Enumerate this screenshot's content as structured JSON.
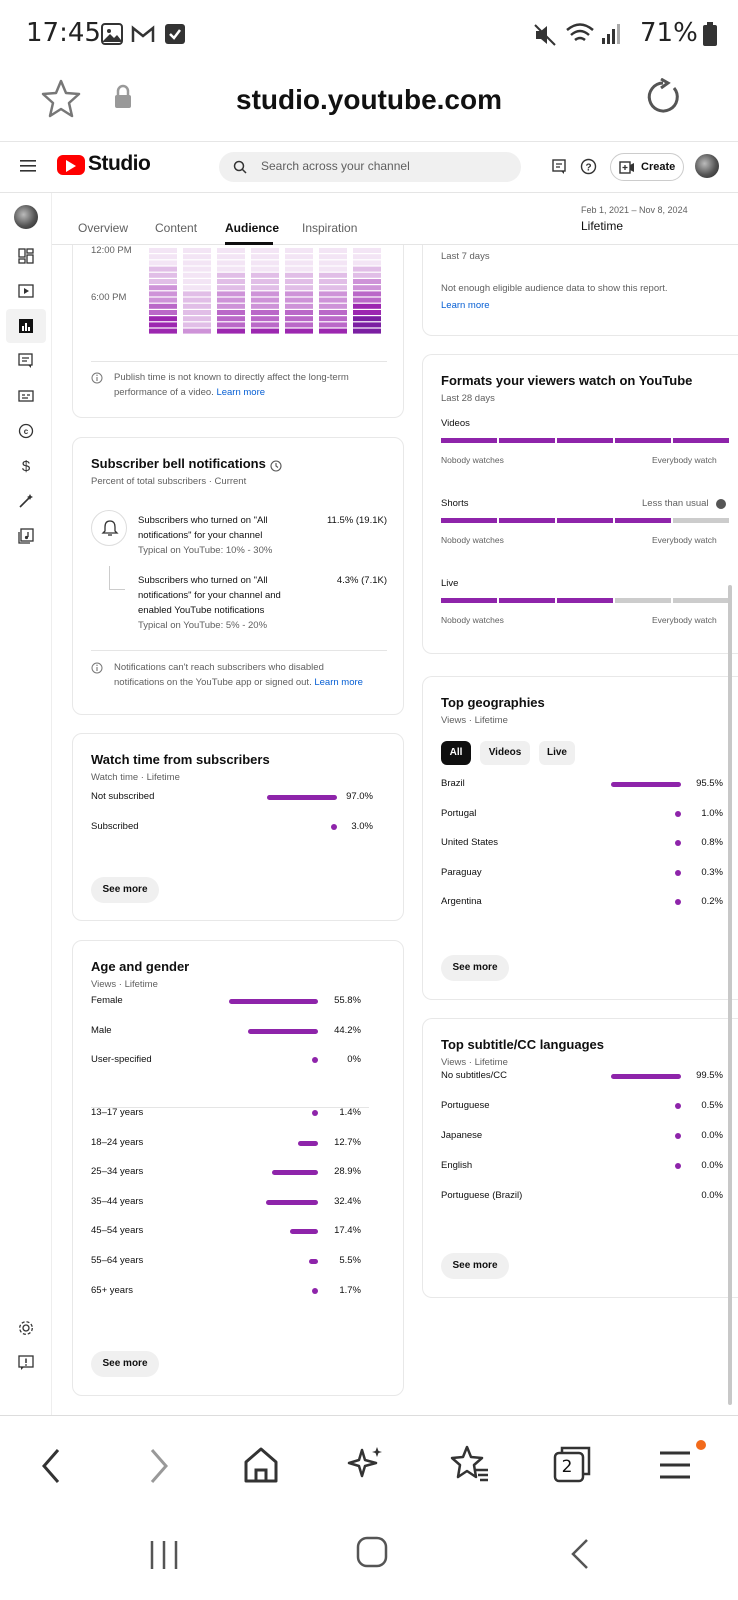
{
  "status_bar": {
    "time": "17:45",
    "battery": "71%"
  },
  "browser": {
    "url": "studio.youtube.com",
    "tab_count": "2"
  },
  "header": {
    "logo": "Studio",
    "search_placeholder": "Search across your channel",
    "create_label": "Create"
  },
  "tabs": {
    "items": [
      "Overview",
      "Content",
      "Audience",
      "Inspiration"
    ],
    "active": "Audience"
  },
  "date_range": {
    "range": "Feb 1, 2021 – Nov 8, 2024",
    "label": "Lifetime"
  },
  "heatmap": {
    "y_labels": [
      "12:00 PM",
      "6:00 PM"
    ],
    "note": "Publish time is not known to directly affect the long-term performance of a video.",
    "note_link": "Learn more",
    "note_line1": "Publish time is not known to directly affect the long-term",
    "note_line2": "performance of a video."
  },
  "bell": {
    "title": "Subscriber bell notifications",
    "subtitle": "Percent of total subscribers · Current",
    "row1": {
      "line1": "Subscribers who turned on \"All",
      "line2": "notifications\" for your channel",
      "typical": "Typical on YouTube: 10% - 30%",
      "value": "11.5% (19.1K)"
    },
    "row2": {
      "line1": "Subscribers who turned on \"All",
      "line2": "notifications\" for your channel and",
      "line3": "enabled YouTube notifications",
      "typical": "Typical on YouTube: 5% - 20%",
      "value": "4.3% (7.1K)"
    },
    "note_line1": "Notifications can't reach subscribers who disabled",
    "note_line2": "notifications on the YouTube app or signed out.",
    "note_link": "Learn more"
  },
  "watch_time": {
    "title": "Watch time from subscribers",
    "subtitle": "Watch time · Lifetime",
    "rows": [
      {
        "label": "Not subscribed",
        "value": "97.0%",
        "pct": 97.0
      },
      {
        "label": "Subscribed",
        "value": "3.0%",
        "pct": 3.0
      }
    ],
    "see_more": "See more"
  },
  "age_gender": {
    "title": "Age and gender",
    "subtitle": "Views · Lifetime",
    "gender": [
      {
        "label": "Female",
        "value": "55.8%",
        "pct": 55.8
      },
      {
        "label": "Male",
        "value": "44.2%",
        "pct": 44.2
      },
      {
        "label": "User-specified",
        "value": "0%",
        "pct": 0
      }
    ],
    "age": [
      {
        "label": "13–17 years",
        "value": "1.4%",
        "pct": 1.4
      },
      {
        "label": "18–24 years",
        "value": "12.7%",
        "pct": 12.7
      },
      {
        "label": "25–34 years",
        "value": "28.9%",
        "pct": 28.9
      },
      {
        "label": "35–44 years",
        "value": "32.4%",
        "pct": 32.4
      },
      {
        "label": "45–54 years",
        "value": "17.4%",
        "pct": 17.4
      },
      {
        "label": "55–64 years",
        "value": "5.5%",
        "pct": 5.5
      },
      {
        "label": "65+ years",
        "value": "1.7%",
        "pct": 1.7
      }
    ],
    "see_more": "See more"
  },
  "audience_data": {
    "period": "Last 7 days",
    "message": "Not enough eligible audience data to show this report.",
    "link": "Learn more"
  },
  "formats": {
    "title": "Formats your viewers watch on YouTube",
    "subtitle": "Last 28 days",
    "rows": [
      {
        "label": "Videos",
        "note": "",
        "filled_segments": 5
      },
      {
        "label": "Shorts",
        "note": "Less than usual",
        "filled_segments": 4
      },
      {
        "label": "Live",
        "note": "",
        "filled_segments": 3
      }
    ],
    "scale_left": "Nobody watches",
    "scale_right": "Everybody watch"
  },
  "geographies": {
    "title": "Top geographies",
    "subtitle": "Views · Lifetime",
    "filters": [
      "All",
      "Videos",
      "Live"
    ],
    "active_filter": "All",
    "rows": [
      {
        "label": "Brazil",
        "value": "95.5%",
        "pct": 95.5
      },
      {
        "label": "Portugal",
        "value": "1.0%",
        "pct": 1.0
      },
      {
        "label": "United States",
        "value": "0.8%",
        "pct": 0.8
      },
      {
        "label": "Paraguay",
        "value": "0.3%",
        "pct": 0.3
      },
      {
        "label": "Argentina",
        "value": "0.2%",
        "pct": 0.2
      }
    ],
    "see_more": "See more"
  },
  "subtitles": {
    "title": "Top subtitle/CC languages",
    "subtitle": "Views · Lifetime",
    "rows": [
      {
        "label": "No subtitles/CC",
        "value": "99.5%",
        "pct": 99.5
      },
      {
        "label": "Portuguese",
        "value": "0.5%",
        "pct": 0.5
      },
      {
        "label": "Japanese",
        "value": "0.0%",
        "pct": 0.0
      },
      {
        "label": "English",
        "value": "0.0%",
        "pct": 0.0
      },
      {
        "label": "Portuguese (Brazil)",
        "value": "0.0%",
        "pct": 0.0
      }
    ],
    "see_more": "See more"
  },
  "colors": {
    "accent": "#8e24aa",
    "youtube_red": "#ff0000",
    "link": "#065fd4"
  }
}
